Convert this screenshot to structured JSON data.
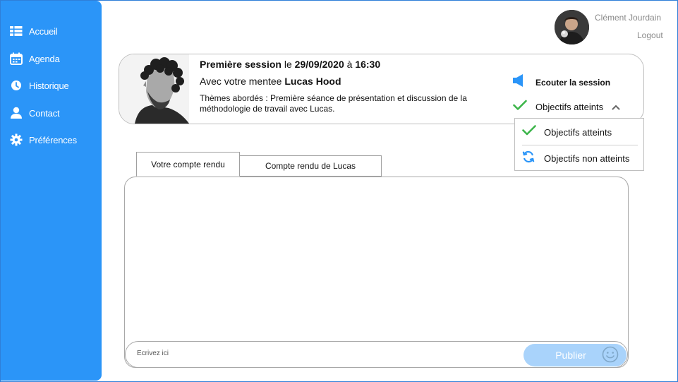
{
  "colors": {
    "sidebar": "#2b95f8",
    "accent": "#2b95f8",
    "check": "#3cb54a",
    "publish_bg": "#a9d3fb"
  },
  "sidebar": {
    "items": [
      {
        "label": "Accueil",
        "icon": "dashboard-icon"
      },
      {
        "label": "Agenda",
        "icon": "calendar-icon"
      },
      {
        "label": "Historique",
        "icon": "clock-icon"
      },
      {
        "label": "Contact",
        "icon": "person-icon"
      },
      {
        "label": "Préférences",
        "icon": "gear-icon"
      }
    ]
  },
  "user": {
    "name": "Clément Jourdain",
    "logout": "Logout"
  },
  "session": {
    "title": "Première session",
    "le": " le ",
    "date": "29/09/2020",
    "a": " à ",
    "time": "16:30",
    "mentee_prefix": "Avec votre mentee ",
    "mentee_name": "Lucas Hood",
    "themes": "Thèmes abordés : Première séance de présentation et discussion de la méthodologie de travail avec Lucas.",
    "listen_label": "Ecouter la session",
    "objectives_selected": "Objectifs atteints"
  },
  "dropdown": {
    "options": [
      {
        "label": "Objectifs atteints",
        "icon": "check-icon"
      },
      {
        "label": "Objectifs non atteints",
        "icon": "refresh-icon"
      }
    ]
  },
  "tabs": [
    {
      "label": "Votre compte rendu"
    },
    {
      "label": "Compte rendu de Lucas"
    }
  ],
  "composer": {
    "placeholder": "Ecrivez ici",
    "publish_label": "Publier"
  }
}
